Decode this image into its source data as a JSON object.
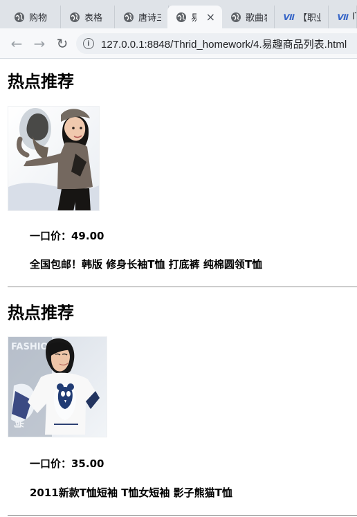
{
  "browser": {
    "tabs": [
      {
        "label": "购物",
        "icon": "globe-icon",
        "active": false
      },
      {
        "label": "表格",
        "icon": "globe-icon",
        "active": false
      },
      {
        "label": "唐诗三",
        "icon": "globe-icon",
        "active": false
      },
      {
        "label": "易趣",
        "icon": "globe-icon",
        "active": true,
        "close": "×"
      },
      {
        "label": "歌曲表",
        "icon": "globe-icon",
        "active": false
      },
      {
        "label": "【职业",
        "icon": "site-icon",
        "active": false
      },
      {
        "label": "IT",
        "icon": "site-icon",
        "active": false
      }
    ],
    "site_icon_text": "Ⅶ",
    "toolbar": {
      "back": "←",
      "forward": "→",
      "reload": "↻",
      "info": "i",
      "url": "127.0.0.1:8848/Thrid_homework/4.易趣商品列表.html"
    }
  },
  "page": {
    "sections": [
      {
        "title": "热点推荐",
        "price_label": "一口价：49.00",
        "description": "全国包邮！韩版 修身长袖T恤 打底裤 纯棉圆领T恤",
        "image_name": "product-photo-long-sleeve-t-shirt"
      },
      {
        "title": "热点推荐",
        "price_label": "一口价：35.00",
        "description": "2011新款T恤短袖 T恤女短袖 影子熊猫T恤",
        "image_name": "product-photo-short-sleeve-t-shirt",
        "image_text": {
          "headline": "FASHION",
          "side": "时尚"
        }
      }
    ]
  },
  "colors": {
    "tabbar": "#dfe3e8",
    "toolbar": "#f7f8fa",
    "address": "#eceff3",
    "text": "#000000",
    "divider": "#8f8f8f",
    "site_icon": "#3866c7"
  }
}
